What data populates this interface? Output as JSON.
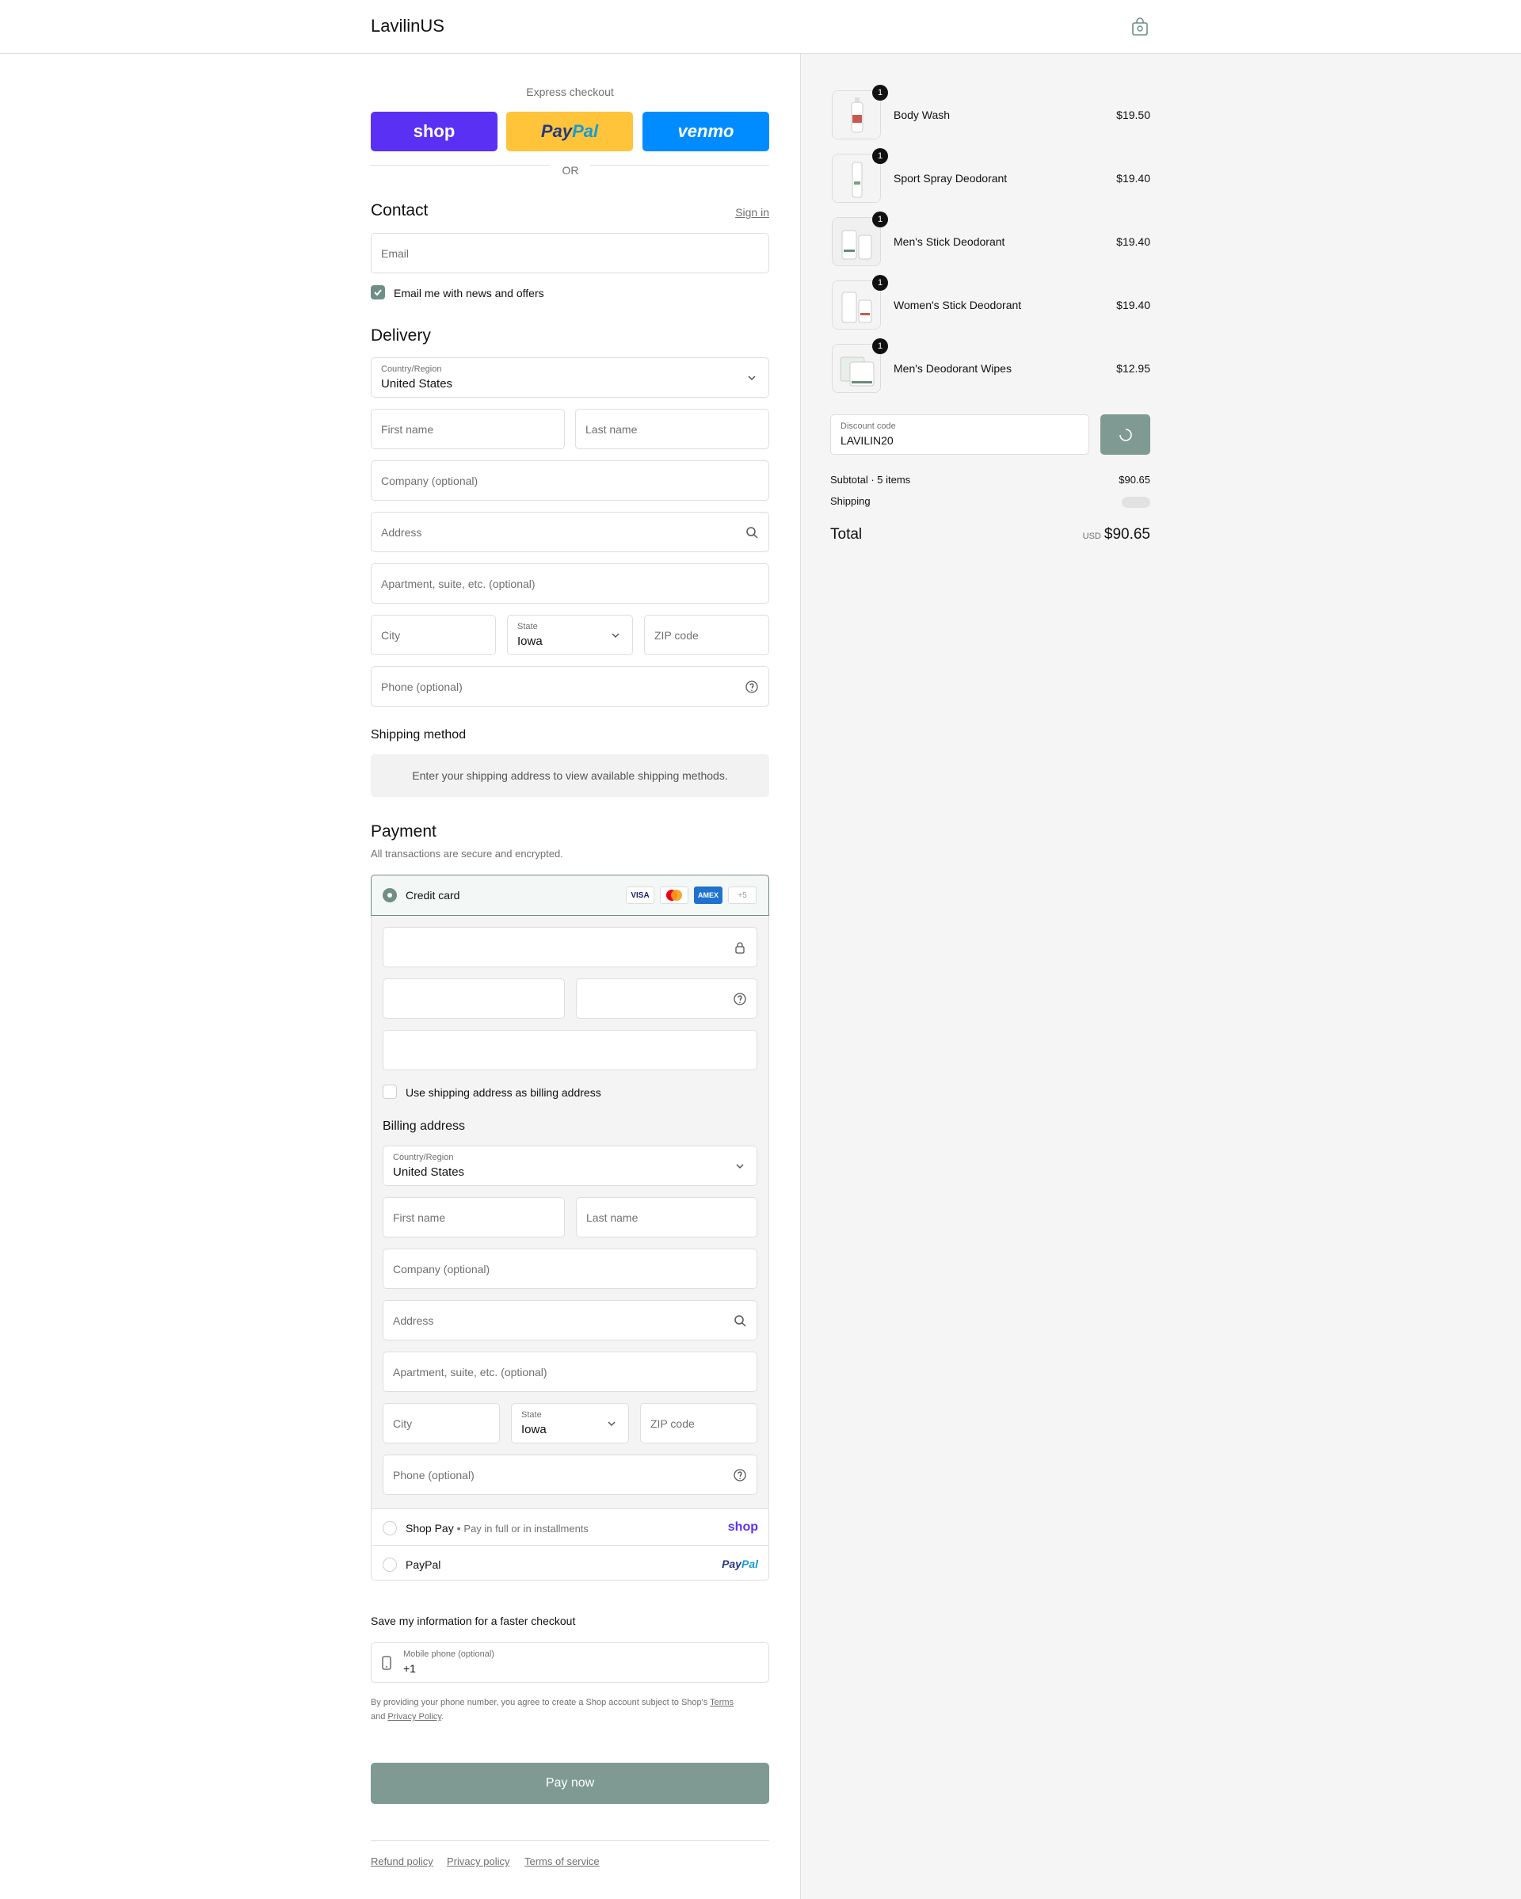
{
  "header": {
    "store_name": "LavilinUS"
  },
  "express": {
    "title": "Express checkout",
    "shop_label": "shop",
    "paypal_label_a": "Pay",
    "paypal_label_b": "Pal",
    "venmo_label": "venmo",
    "or_text": "OR"
  },
  "contact": {
    "title": "Contact",
    "sign_in": "Sign in",
    "email_placeholder": "Email",
    "news_label": "Email me with news and offers"
  },
  "delivery": {
    "title": "Delivery",
    "country_label": "Country/Region",
    "country_value": "United States",
    "first_name": "First name",
    "last_name": "Last name",
    "company": "Company (optional)",
    "address": "Address",
    "apartment": "Apartment, suite, etc. (optional)",
    "city": "City",
    "state_label": "State",
    "state_value": "Iowa",
    "zip": "ZIP code",
    "phone": "Phone (optional)"
  },
  "shipping_method": {
    "title": "Shipping method",
    "message": "Enter your shipping address to view available shipping methods."
  },
  "payment": {
    "title": "Payment",
    "subtitle": "All transactions are secure and encrypted.",
    "credit_card": "Credit card",
    "visa": "VISA",
    "amex": "AMEX",
    "more_cards": "+5",
    "same_address": "Use shipping address as billing address",
    "billing_title": "Billing address",
    "shop_pay": "Shop Pay",
    "shop_pay_desc": "Pay in full or in installments",
    "shop_pay_logo": "shop",
    "paypal": "PayPal",
    "paypal_logo_a": "Pay",
    "paypal_logo_b": "Pal"
  },
  "save_info": {
    "title": "Save my information for a faster checkout",
    "phone_label": "Mobile phone (optional)",
    "phone_value": "+1",
    "legal_1": "By providing your phone number, you agree to create a Shop account subject to Shop's ",
    "terms": "Terms",
    "legal_2": "and ",
    "privacy": "Privacy Policy",
    "legal_3": "."
  },
  "pay_now": "Pay now",
  "footer": {
    "refund": "Refund policy",
    "privacy": "Privacy policy",
    "terms": "Terms of service"
  },
  "summary": {
    "items": [
      {
        "name": "Body Wash",
        "price": "$19.50",
        "qty": "1"
      },
      {
        "name": "Sport Spray Deodorant",
        "price": "$19.40",
        "qty": "1"
      },
      {
        "name": "Men's Stick Deodorant",
        "price": "$19.40",
        "qty": "1"
      },
      {
        "name": "Women's Stick Deodorant",
        "price": "$19.40",
        "qty": "1"
      },
      {
        "name": "Men's Deodorant Wipes",
        "price": "$12.95",
        "qty": "1"
      }
    ],
    "discount_label": "Discount code",
    "discount_value": "LAVILIN20",
    "subtotal_label": "Subtotal · 5 items",
    "subtotal_value": "$90.65",
    "shipping_label": "Shipping",
    "total_label": "Total",
    "currency": "USD",
    "total_value": "$90.65"
  },
  "colors": {
    "accent": "#6f8f86",
    "pay_button": "#7f9a92",
    "shop_purple": "#5a31f4",
    "paypal_yellow": "#ffc439",
    "venmo_blue": "#008cff"
  }
}
